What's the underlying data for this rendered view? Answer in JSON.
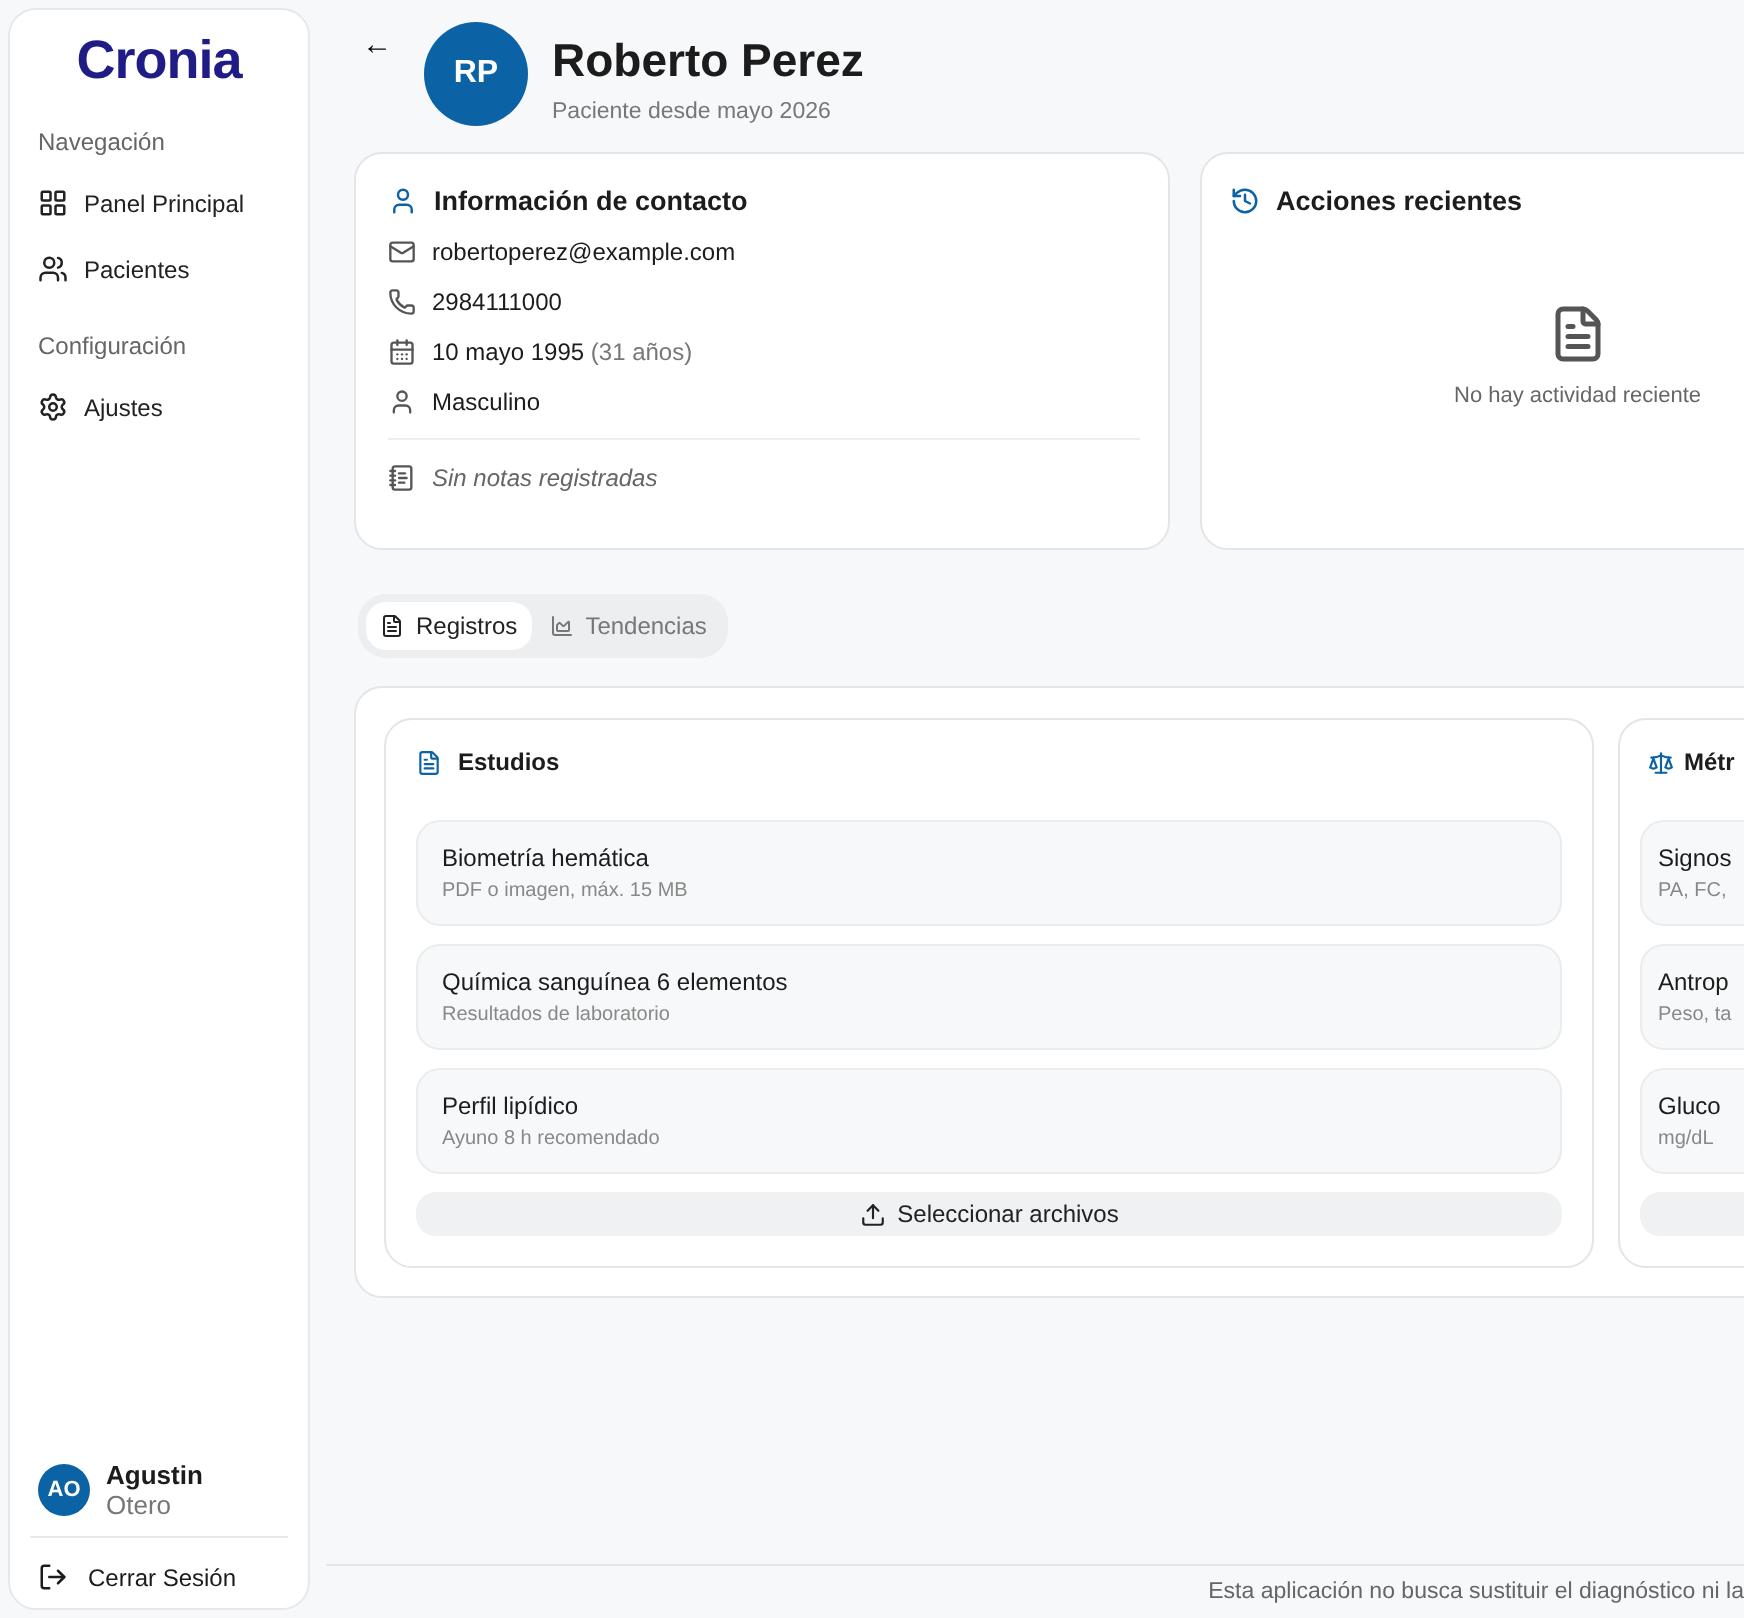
{
  "sidebar": {
    "logo": "Cronia",
    "sections": [
      {
        "title": "Navegación",
        "items": [
          {
            "label": "Panel Principal",
            "selected": false
          },
          {
            "label": "Pacientes",
            "selected": false
          }
        ]
      },
      {
        "title": "Configuración",
        "items": [
          {
            "label": "Ajustes",
            "selected": false
          }
        ]
      }
    ],
    "user": {
      "initials": "AO",
      "first_name": "Agustin",
      "last_name": "Otero"
    },
    "logout": "Cerrar Sesión"
  },
  "header": {
    "back": "←",
    "initials": "RP",
    "name": "Roberto Perez",
    "subtitle": "Paciente desde mayo 2026"
  },
  "contact": {
    "title": "Información de contacto",
    "rows": [
      {
        "text": "robertoperez@example.com"
      },
      {
        "text": "2984111000"
      },
      {
        "text": "10 mayo 1995",
        "extra": "(31 años)"
      },
      {
        "text": "Masculino"
      }
    ],
    "notes": "Sin notas registradas"
  },
  "recent": {
    "title": "Acciones recientes",
    "empty": "No hay actividad reciente"
  },
  "tabs": [
    {
      "label": "Registros",
      "selected": true
    },
    {
      "label": "Tendencias",
      "selected": false
    }
  ],
  "panels": [
    {
      "title": "Estudios",
      "items": [
        {
          "title": "Biometría hemática",
          "subtitle": "PDF o imagen, máx. 15 MB"
        },
        {
          "title": "Química sanguínea 6 elementos",
          "subtitle": "Resultados de laboratorio"
        },
        {
          "title": "Perfil lipídico",
          "subtitle": "Ayuno 8 h recomendado"
        }
      ],
      "button": "Seleccionar archivos"
    },
    {
      "title": "Métr",
      "items": [
        {
          "title": "Signos",
          "subtitle": "PA, FC,"
        },
        {
          "title": "Antrop",
          "subtitle": "Peso, ta"
        },
        {
          "title": "Gluco",
          "subtitle": "mg/dL"
        }
      ]
    }
  ],
  "footer": "Esta aplicación no busca sustituir el diagnóstico ni la"
}
